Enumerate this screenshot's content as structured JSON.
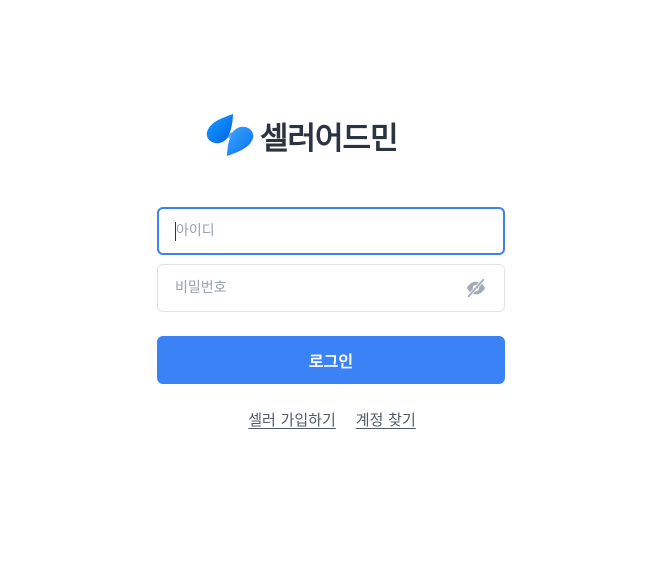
{
  "brand": {
    "name": "셀러어드민",
    "logo_icon": "brand-leaf-logo",
    "logo_colors": [
      "#0a84ff",
      "#005ce6"
    ]
  },
  "login_form": {
    "id_placeholder": "아이디",
    "password_placeholder": "비밀번호",
    "password_toggle_icon": "eye-off-icon",
    "submit_label": "로그인"
  },
  "links": {
    "signup": "셀러 가입하기",
    "find_account": "계정 찾기"
  },
  "colors": {
    "accent": "#3b82f6",
    "brand_text": "#2b3440",
    "link_text": "#525c68"
  }
}
